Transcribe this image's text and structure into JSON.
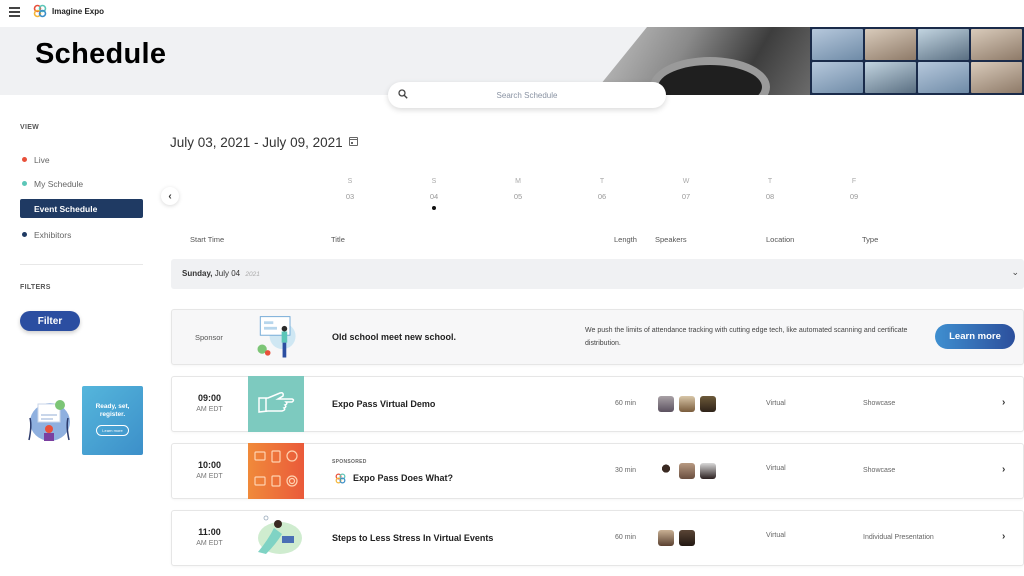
{
  "app": {
    "brand": "Imagine Expo"
  },
  "header": {
    "title": "Schedule"
  },
  "search": {
    "placeholder": "Search Schedule",
    "value": ""
  },
  "sidebar": {
    "view_heading": "VIEW",
    "items": [
      {
        "label": "Live",
        "dot_color": "#e8503a",
        "active": false
      },
      {
        "label": "My Schedule",
        "dot_color": "#5cc6b8",
        "active": false
      },
      {
        "label": "Event Schedule",
        "dot_color": "#1f3a63",
        "active": true
      },
      {
        "label": "Exhibitors",
        "dot_color": "#1f3a63",
        "active": false
      }
    ],
    "filters_heading": "FILTERS",
    "filter_button": "Filter",
    "promo": {
      "text_line1": "Ready, set,",
      "text_line2": "register.",
      "button": "Learn more"
    }
  },
  "calendar": {
    "range": "July 03, 2021 - July 09, 2021",
    "days": [
      {
        "letter": "S",
        "num": "03",
        "selected": false
      },
      {
        "letter": "S",
        "num": "04",
        "selected": true
      },
      {
        "letter": "M",
        "num": "05",
        "selected": false
      },
      {
        "letter": "T",
        "num": "06",
        "selected": false
      },
      {
        "letter": "W",
        "num": "07",
        "selected": false
      },
      {
        "letter": "T",
        "num": "08",
        "selected": false
      },
      {
        "letter": "F",
        "num": "09",
        "selected": false
      }
    ]
  },
  "columns": {
    "start_time": "Start Time",
    "title": "Title",
    "length": "Length",
    "speakers": "Speakers",
    "location": "Location",
    "type": "Type"
  },
  "day_group": {
    "weekday": "Sunday,",
    "date": "July 04",
    "year": "2021"
  },
  "sponsor_row": {
    "label": "Sponsor",
    "title": "Old school meet new school.",
    "description": "We push the limits of attendance tracking with cutting edge tech, like automated scanning and certificate distribution.",
    "button": "Learn more"
  },
  "sessions": [
    {
      "time": "09:00",
      "zone": "AM EDT",
      "title": "Expo Pass Virtual Demo",
      "tag": "",
      "length": "60 min",
      "speaker_count": 3,
      "location": "Virtual",
      "type": "Showcase"
    },
    {
      "time": "10:00",
      "zone": "AM EDT",
      "title": "Expo Pass Does What?",
      "tag": "SPONSORED",
      "length": "30 min",
      "speaker_count": 3,
      "location": "Virtual",
      "type": "Showcase"
    },
    {
      "time": "11:00",
      "zone": "AM EDT",
      "title": "Steps to Less Stress In Virtual Events",
      "tag": "",
      "length": "60 min",
      "speaker_count": 2,
      "location": "Virtual",
      "type": "Individual Presentation"
    }
  ],
  "colors": {
    "primary": "#1f3a63",
    "filter_button": "#2b4ea1",
    "live": "#e8503a",
    "my_schedule": "#5cc6b8"
  }
}
